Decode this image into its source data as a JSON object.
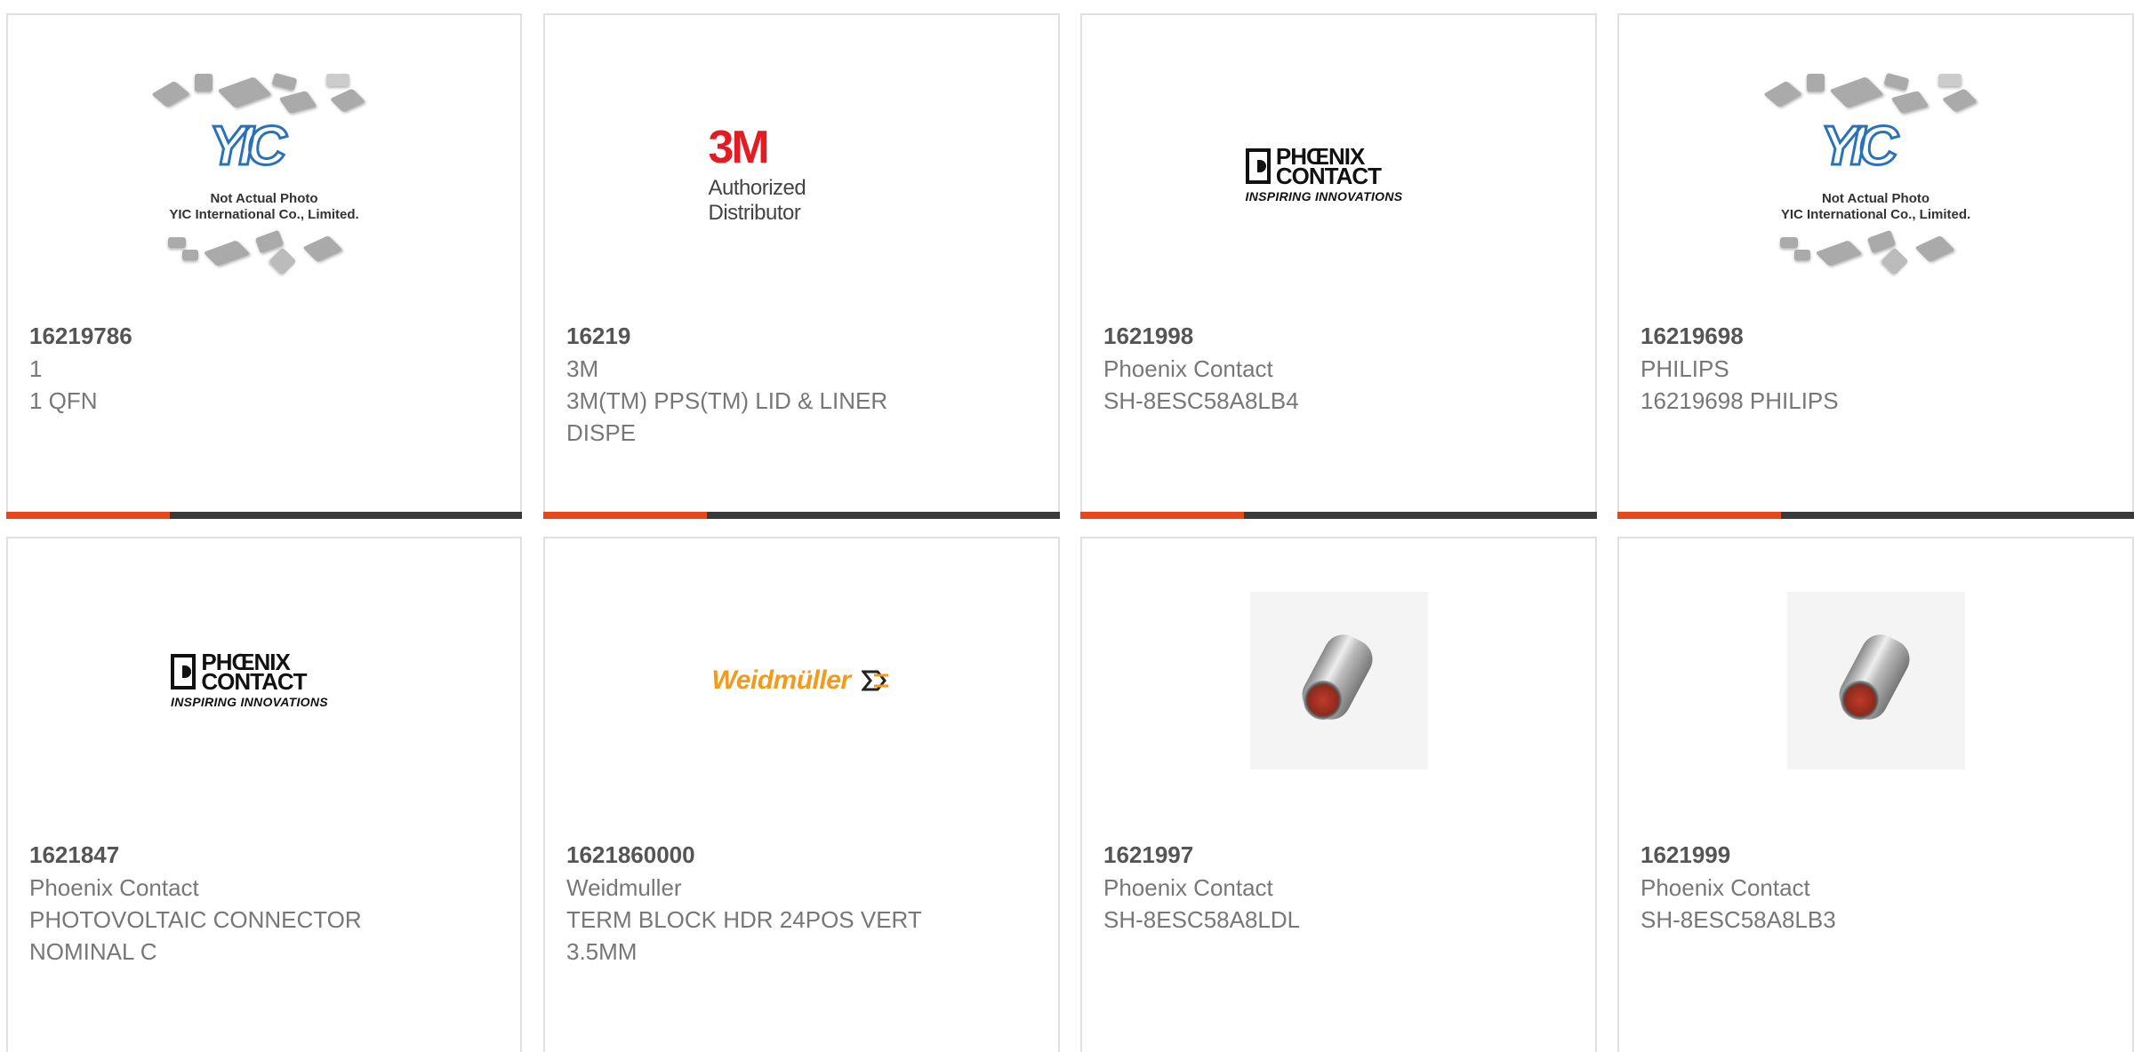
{
  "accent_color": "#e8461b",
  "bar_color": "#3a3a3a",
  "products": [
    {
      "part_number": "16219786",
      "manufacturer": "1",
      "description": "1 QFN",
      "image": "not-actual-photo",
      "image_text": [
        "Not Actual Photo",
        "YIC International Co., Limited."
      ],
      "image_logo": "YIC"
    },
    {
      "part_number": "16219",
      "manufacturer": "3M",
      "description": "3M(TM) PPS(TM) LID & LINER DISPE",
      "image": "3m-logo",
      "image_logo": "3M",
      "image_text": [
        "Authorized Distributor"
      ]
    },
    {
      "part_number": "1621998",
      "manufacturer": "Phoenix Contact",
      "description": "SH-8ESC58A8LB4",
      "image": "phoenix-contact-logo",
      "image_logo": "PHŒNIX CONTACT",
      "image_tagline": "INSPIRING INNOVATIONS"
    },
    {
      "part_number": "16219698",
      "manufacturer": "PHILIPS",
      "description": "16219698 PHILIPS",
      "image": "not-actual-photo",
      "image_text": [
        "Not Actual Photo",
        "YIC International Co., Limited."
      ],
      "image_logo": "YIC"
    },
    {
      "part_number": "1621847",
      "manufacturer": "Phoenix Contact",
      "description": "PHOTOVOLTAIC CONNECTOR NOMINAL C",
      "image": "phoenix-contact-logo",
      "image_logo": "PHŒNIX CONTACT",
      "image_tagline": "INSPIRING INNOVATIONS"
    },
    {
      "part_number": "1621860000",
      "manufacturer": "Weidmuller",
      "description": "TERM BLOCK HDR 24POS VERT 3.5MM",
      "image": "weidmuller-logo",
      "image_logo": "Weidmüller"
    },
    {
      "part_number": "1621997",
      "manufacturer": "Phoenix Contact",
      "description": "SH-8ESC58A8LDL",
      "image": "circular-connector-photo"
    },
    {
      "part_number": "1621999",
      "manufacturer": "Phoenix Contact",
      "description": "SH-8ESC58A8LB3",
      "image": "circular-connector-photo"
    }
  ]
}
